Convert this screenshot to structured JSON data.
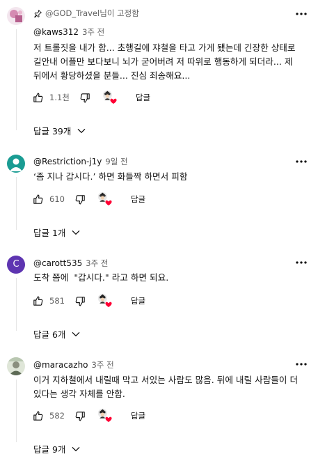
{
  "comments": [
    {
      "pinned_label": "@GOD_Travel님이 고정함",
      "author": "@kaws312",
      "time": "3주 전",
      "text": "저 트롤짓을 내가 함... 초행길에 쟈철을 타고 가게 됐는데 긴장한 상태로 길안내 어플만 보다보니 뇌가 굳어버려 저 따위로 행동하게 되더라... 제 뒤에서 황당하셨을 분들... 진심 죄송해요...",
      "likes": "1.1천",
      "reply_label": "답글",
      "replies_label": "답글 39개"
    },
    {
      "author": "@Restriction-j1y",
      "time": "9일 전",
      "text": "‘좀 지나 갑시다.’ 하면 화들짝 하면서 피함",
      "likes": "610",
      "reply_label": "답글",
      "replies_label": "답글 1개"
    },
    {
      "avatar_letter": "C",
      "author": "@carott535",
      "time": "3주 전",
      "text": "도착 쯤에  \"갑시다.\" 라고 하면 되요.",
      "likes": "581",
      "reply_label": "답글",
      "replies_label": "답글 6개"
    },
    {
      "author": "@maracazho",
      "time": "3주 전",
      "text": "이거 지하철에서 내릴때 막고 서있는 사람도 많음. 뒤에 내릴 사람들이 더 있다는 생각 자체를 안함.",
      "likes": "582",
      "reply_label": "답글",
      "replies_label": "답글 9개"
    }
  ],
  "colors": {
    "heart": "#ff0033",
    "avatar_c": "#5e35b1",
    "meta_text": "#606060"
  },
  "icons": [
    "pin-icon",
    "more-vert-icon",
    "thumb-up-icon",
    "thumb-down-icon",
    "creator-heart-icon",
    "chevron-down-icon"
  ]
}
